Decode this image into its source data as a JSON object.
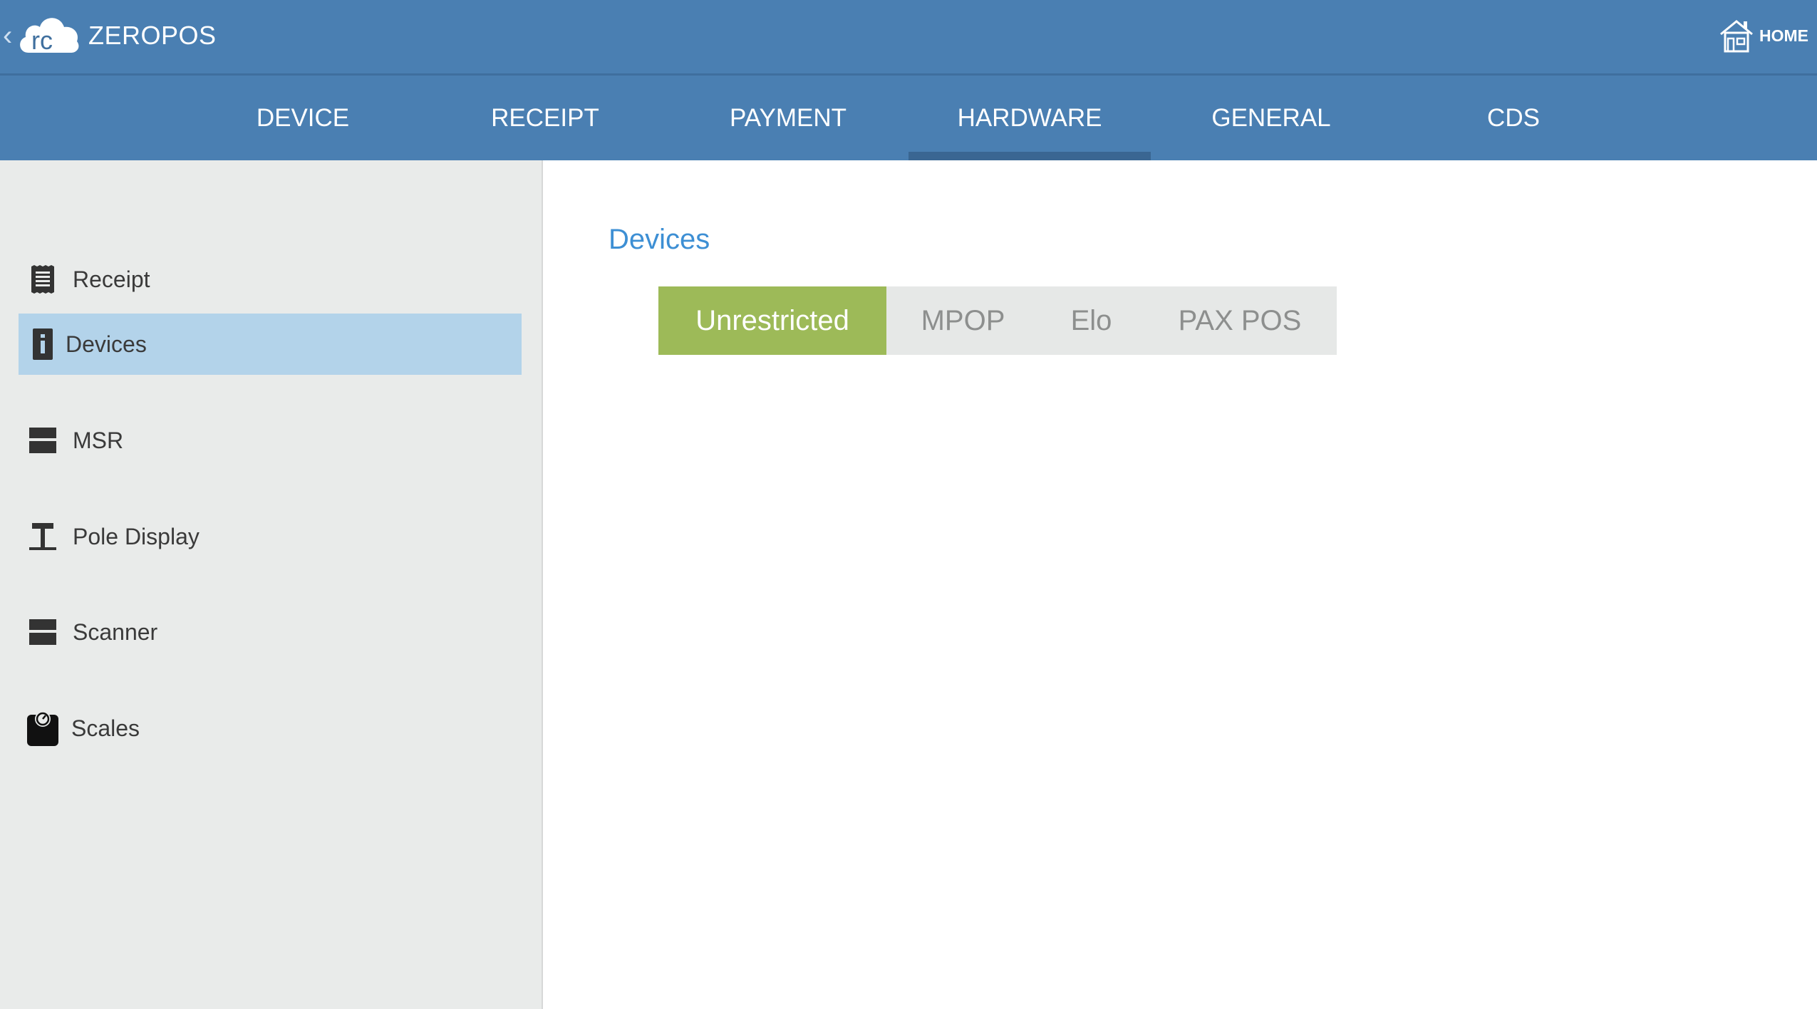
{
  "app": {
    "title": "ZEROPOS",
    "back_glyph": "‹",
    "logo_text": "rc"
  },
  "header": {
    "home_label": "HOME"
  },
  "tabs": [
    {
      "label": "DEVICE"
    },
    {
      "label": "RECEIPT"
    },
    {
      "label": "PAYMENT"
    },
    {
      "label": "HARDWARE",
      "active": true
    },
    {
      "label": "GENERAL"
    },
    {
      "label": "CDS"
    }
  ],
  "sidebar": {
    "items": [
      {
        "label": "Receipt",
        "icon": "receipt-icon"
      },
      {
        "label": "Devices",
        "icon": "device-info-icon",
        "selected": true
      },
      {
        "label": "MSR",
        "icon": "msr-icon"
      },
      {
        "label": "Pole Display",
        "icon": "pole-display-icon"
      },
      {
        "label": "Scanner",
        "icon": "scanner-icon"
      },
      {
        "label": "Scales",
        "icon": "scales-icon"
      }
    ]
  },
  "main": {
    "section_title": "Devices",
    "device_types": [
      {
        "label": "Unrestricted",
        "selected": true
      },
      {
        "label": "MPOP"
      },
      {
        "label": "Elo"
      },
      {
        "label": "PAX POS"
      }
    ]
  },
  "colors": {
    "appbar": "#4a7fb2",
    "tab_indicator": "#3a6692",
    "sidebar_bg": "#e9ebea",
    "sidebar_selected": "#b3d3ea",
    "section_title": "#3d8fd4",
    "segment_selected": "#9dba58",
    "segment_bg": "#e6e8e7"
  }
}
